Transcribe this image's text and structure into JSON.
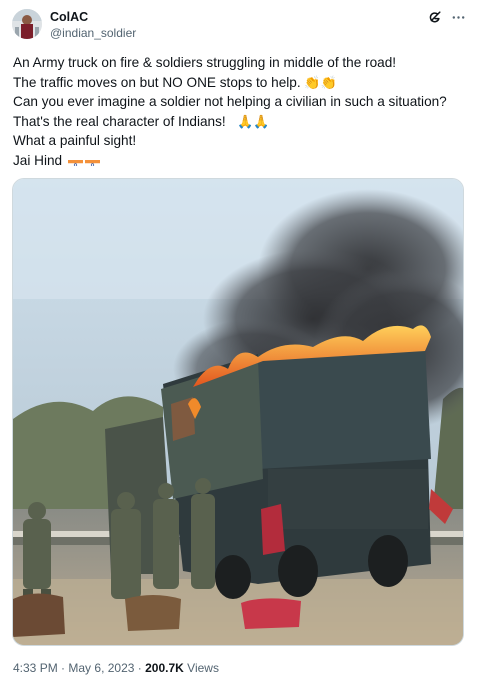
{
  "author": {
    "display_name": "ColAC",
    "handle": "@indian_soldier"
  },
  "tweet_text": {
    "line1": "An Army truck on fire & soldiers struggling in middle of the road!",
    "line2": "The traffic moves on but NO ONE stops to help.",
    "line2_emoji": "👏👏",
    "line3": "Can you ever imagine a soldier not  helping a civilian in such a situation?",
    "line4": "That's the real character of Indians!",
    "line4_emoji": "🙏🙏",
    "line5": "What a painful sight!",
    "line6": "Jai Hind"
  },
  "icons": {
    "header_right": [
      "grok-icon",
      "more-icon"
    ],
    "flags": [
      "india-flag-icon",
      "india-flag-icon"
    ]
  },
  "meta": {
    "time": "4:33 PM",
    "separator": "·",
    "date": "May 6, 2023",
    "views_count": "200.7K",
    "views_label": "Views"
  },
  "colors": {
    "text": "#0f1419",
    "secondary": "#536471",
    "border": "#cfd9de"
  }
}
